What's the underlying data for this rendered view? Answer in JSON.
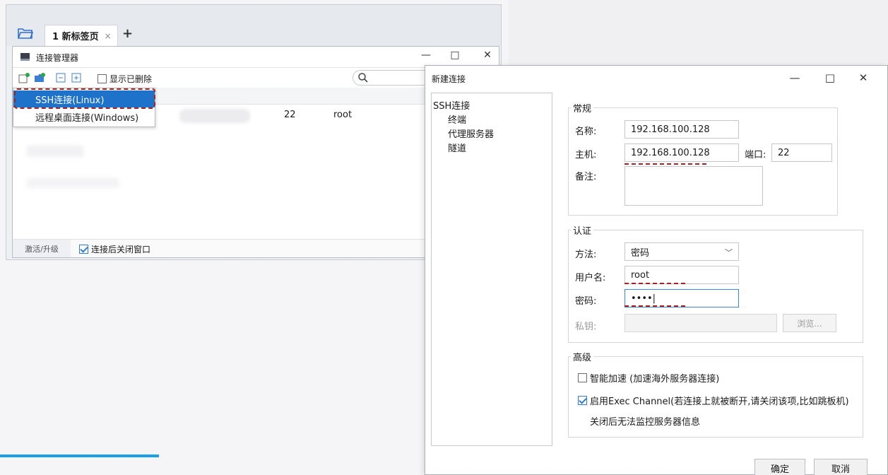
{
  "app": {
    "tab_label": "1 新标签页",
    "tab_close": "×",
    "tab_add": "+"
  },
  "conn_manager": {
    "title": "连接管理器",
    "controls": {
      "minimize": "—",
      "maximize": "□",
      "close": "✕"
    },
    "show_deleted_label": "显示已删除",
    "search_placeholder": "",
    "menu": {
      "ssh_label": "SSH连接(Linux)",
      "rdp_label": "远程桌面连接(Windows)"
    },
    "rows": [
      {
        "port": "22",
        "user": "root"
      }
    ],
    "status": {
      "activate_label": "激活/升级",
      "close_after_label": "连接后关闭窗口"
    }
  },
  "dialog": {
    "title": "新建连接",
    "controls": {
      "minimize": "—",
      "maximize": "□",
      "close": "✕"
    },
    "nav": {
      "root": "SSH连接",
      "terminal": "终端",
      "proxy": "代理服务器",
      "tunnel": "隧道"
    },
    "general": {
      "legend": "常规",
      "name_label": "名称:",
      "name_value": "192.168.100.128",
      "host_label": "主机:",
      "host_value": "192.168.100.128",
      "port_label": "端口:",
      "port_value": "22",
      "note_label": "备注:"
    },
    "auth": {
      "legend": "认证",
      "method_label": "方法:",
      "method_value": "密码",
      "user_label": "用户名:",
      "user_value": "root",
      "password_label": "密码:",
      "password_value": "••••|",
      "key_label": "私钥:",
      "browse_label": "浏览..."
    },
    "advanced": {
      "legend": "高级",
      "accel_label": "智能加速 (加速海外服务器连接)",
      "exec_label": "启用Exec Channel(若连接上就被断开,请关闭该项,比如跳板机)",
      "exec_note": "关闭后无法监控服务器信息"
    },
    "buttons": {
      "ok": "确定",
      "cancel": "取消"
    }
  },
  "colors": {
    "accent": "#1e72c9",
    "highlight_dash": "#a52323",
    "progress_bar": "#1aa2e6"
  }
}
